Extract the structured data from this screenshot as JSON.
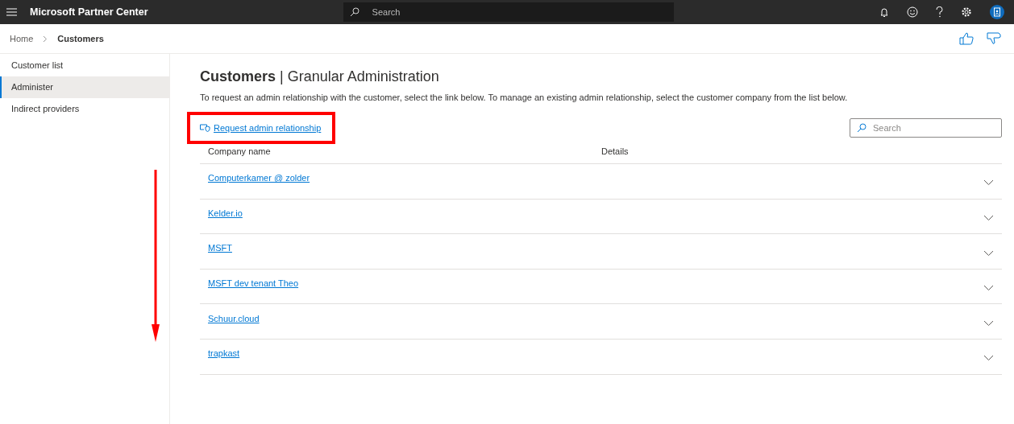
{
  "app": {
    "title": "Microsoft Partner Center",
    "search_placeholder": "Search"
  },
  "breadcrumb": [
    {
      "label": "Home",
      "current": false
    },
    {
      "label": "Customers",
      "current": true
    }
  ],
  "sidebar": {
    "items": [
      {
        "label": "Customer list",
        "selected": false
      },
      {
        "label": "Administer",
        "selected": true
      },
      {
        "label": "Indirect providers",
        "selected": false
      }
    ]
  },
  "page": {
    "title": "**Customers** | Granular Administration",
    "description": "To request an admin relationship with the customer, select the link below. To manage an existing admin relationship, select the customer company from the list below.",
    "request_link": "Request admin relationship",
    "search_placeholder": "Search"
  },
  "table": {
    "columns": [
      "Company name",
      "Details"
    ],
    "rows": [
      {
        "company": "Computerkamer @ zolder",
        "expanded": false
      },
      {
        "company": "Kelder.io",
        "expanded": false
      },
      {
        "company": "MSFT",
        "expanded": false
      },
      {
        "company": "MSFT dev tenant Theo",
        "expanded": false
      },
      {
        "company": "Schuur.cloud",
        "expanded": false
      },
      {
        "company": "trapkast",
        "expanded": false
      }
    ]
  },
  "annotations": {
    "highlight_box": true,
    "down_arrow": true
  }
}
